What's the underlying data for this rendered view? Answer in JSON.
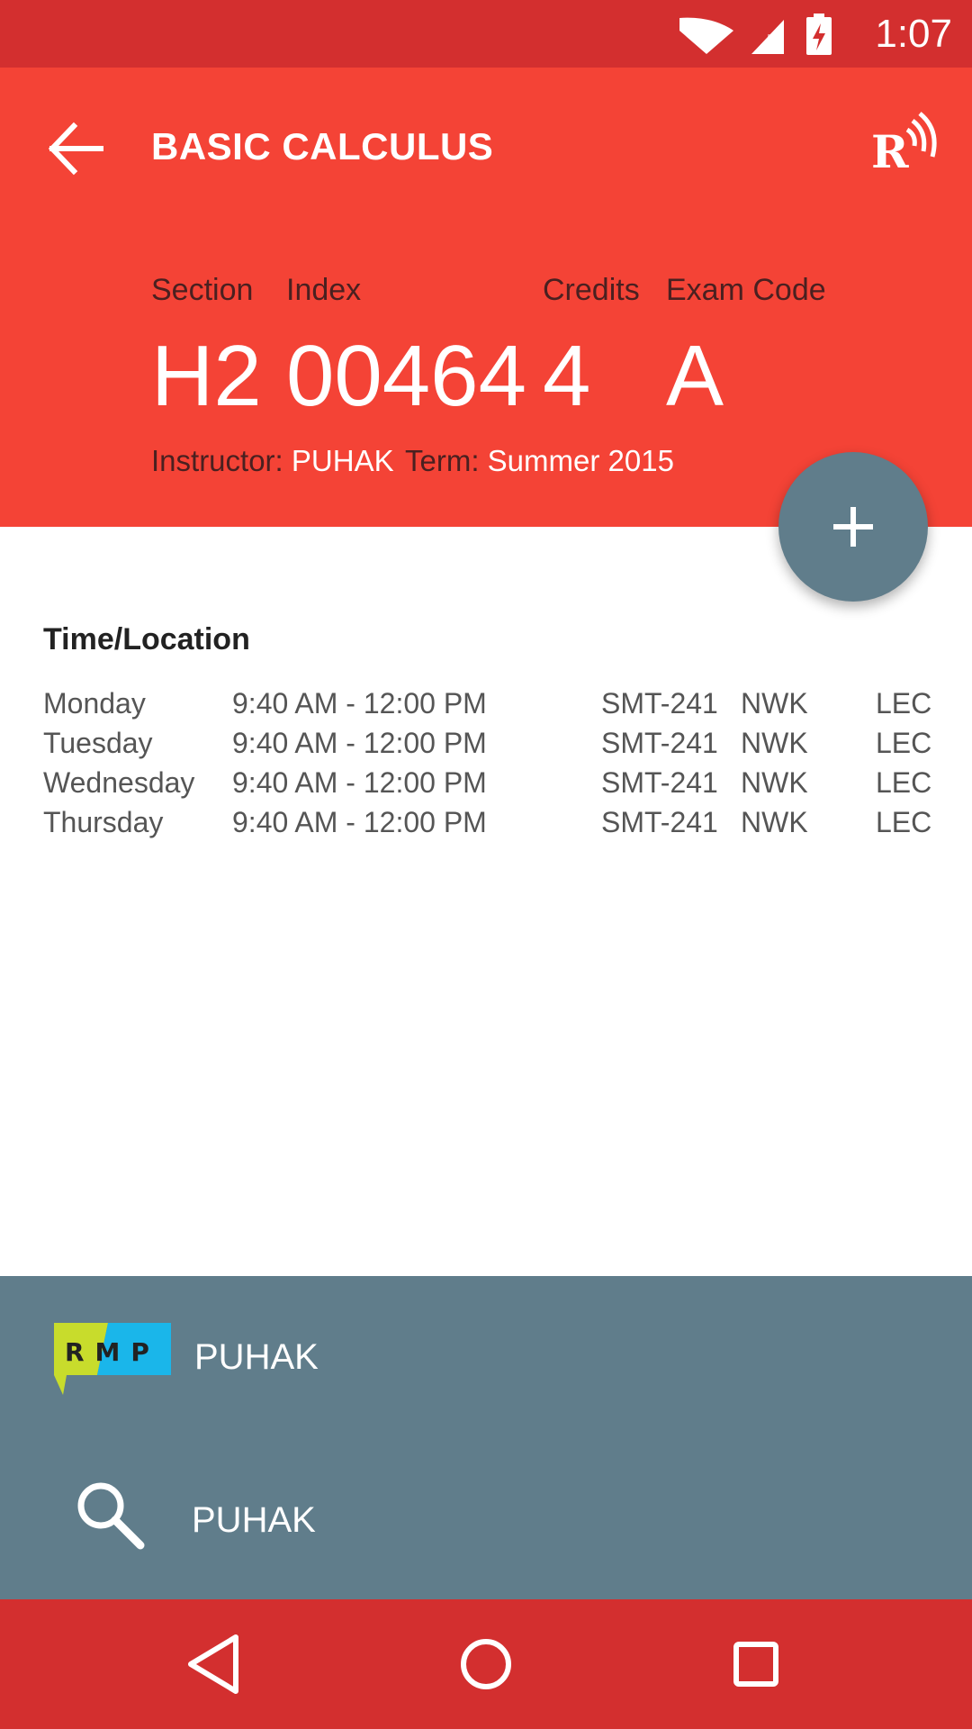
{
  "status_bar": {
    "time": "1:07"
  },
  "header": {
    "title": "BASIC CALCULUS",
    "labels": {
      "section": "Section",
      "index": "Index",
      "credits": "Credits",
      "exam_code": "Exam Code"
    },
    "values": {
      "section": "H2",
      "index": "00464",
      "credits": "4",
      "exam_code": "A"
    },
    "instructor_label": "Instructor:",
    "instructor": "PUHAK",
    "term_label": "Term:",
    "term": "Summer 2015"
  },
  "schedule": {
    "title": "Time/Location",
    "rows": [
      {
        "day": "Monday",
        "time": "9:40 AM - 12:00 PM",
        "room": "SMT-241",
        "campus": "NWK",
        "type": "LEC"
      },
      {
        "day": "Tuesday",
        "time": "9:40 AM - 12:00 PM",
        "room": "SMT-241",
        "campus": "NWK",
        "type": "LEC"
      },
      {
        "day": "Wednesday",
        "time": "9:40 AM - 12:00 PM",
        "room": "SMT-241",
        "campus": "NWK",
        "type": "LEC"
      },
      {
        "day": "Thursday",
        "time": "9:40 AM - 12:00 PM",
        "room": "SMT-241",
        "campus": "NWK",
        "type": "LEC"
      }
    ]
  },
  "bottom_panel": {
    "rmp_item": {
      "label": "PUHAK",
      "logo_text": "RMP"
    },
    "search_item": {
      "label": "PUHAK"
    }
  },
  "icons": {
    "back": "arrow-left-icon",
    "radio": "r-broadcast-icon",
    "fab": "plus-icon",
    "search": "search-icon",
    "nav": [
      "back-triangle-icon",
      "home-circle-icon",
      "recents-square-icon"
    ]
  },
  "colors": {
    "status_bar": "#d32f2f",
    "header": "#f44336",
    "fab": "#607d8b",
    "panel": "#607d8b",
    "nav_bar": "#d32f2f"
  }
}
